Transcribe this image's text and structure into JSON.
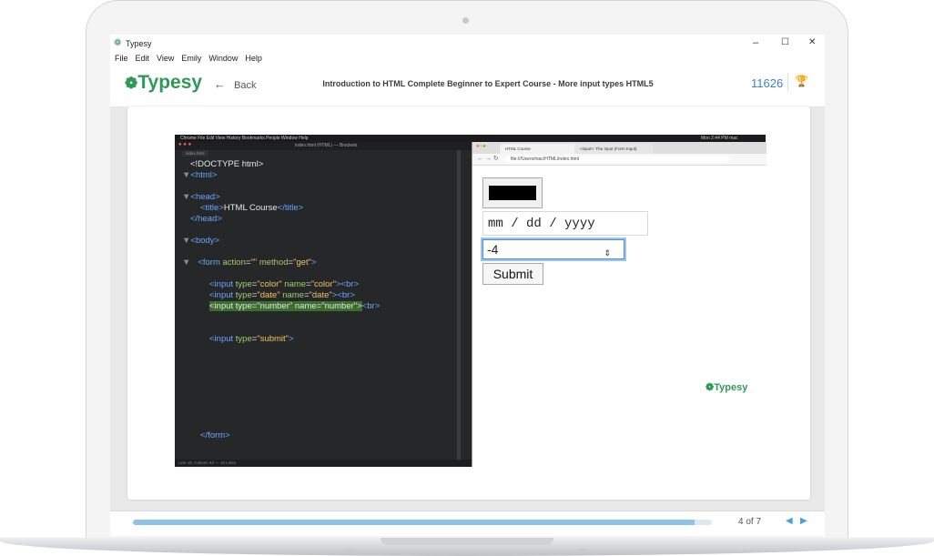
{
  "window": {
    "app_title": "Typesy",
    "menu": [
      "File",
      "Edit",
      "View",
      "Emily",
      "Window",
      "Help"
    ],
    "controls": {
      "minimize": "–",
      "maximize": "☐",
      "close": "✕"
    }
  },
  "header": {
    "logo": "Typesy",
    "back_label": "Back",
    "course_title": "Introduction to HTML Complete Beginner to Expert Course - More input types HTML5",
    "points": "11626"
  },
  "video": {
    "mac_menubar": "Chrome  File  Edit  View  History  Bookmarks  People  Window  Help",
    "mac_clock": "Mon 2:44 PM   mac",
    "editor": {
      "title": "index.html (HTML) — Brackets",
      "tab": "index.html",
      "status": "Line 18, Column 42 — 16 Lines",
      "lines": {
        "doctype": "<!DOCTYPE html>",
        "html_open": "<html>",
        "head_open": "<head>",
        "title_open": "<title>",
        "title_text": "HTML Course",
        "title_close": "</title>",
        "head_close": "</head>",
        "body_open": "<body>",
        "form_tag_open": "<form ",
        "form_attr1": "action",
        "form_val1": "\"\"",
        "form_attr2": " method",
        "form_val2": "\"get\"",
        "form_tag_end": ">",
        "input_tag": "<input ",
        "type_attr": "type",
        "name_attr": " name",
        "color_val": "\"color\"",
        "date_val": "\"date\"",
        "submit_val": "\"submit\"",
        "number_line": "<input type=\"number\" name=\"number\">",
        "close_bracket": ">",
        "br": "<br>",
        "eq": "=",
        "form_close": "</form>"
      }
    },
    "browser": {
      "tab1": "HTML Course",
      "tab2": "<input>: The Input (Form Input)",
      "url": "file:///Users/mac/HTML/index.html",
      "date_placeholder": "mm / dd / yyyy",
      "number_value": "-4",
      "submit_label": "Submit",
      "color_value": "#000000"
    },
    "watermark": "Typesy"
  },
  "footer": {
    "page_info": "4 of 7",
    "progress": 0.97,
    "prev": "◀",
    "next": "▶"
  }
}
